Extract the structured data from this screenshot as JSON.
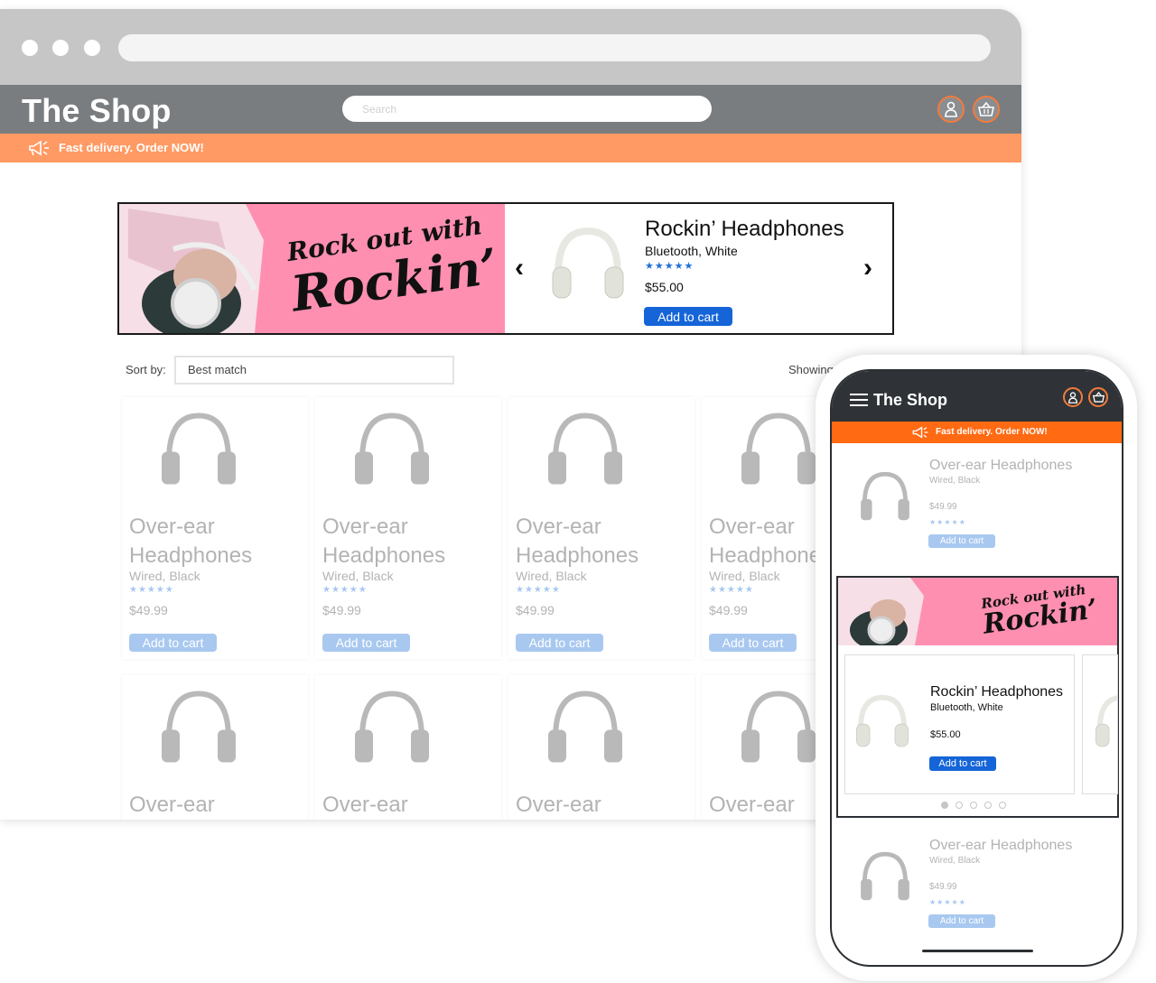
{
  "desktop": {
    "brand": "The Shop",
    "search_placeholder": "Search",
    "promo": "Fast delivery. Order NOW!",
    "hero": {
      "tagline_line1": "Rock out with",
      "tagline_line2": "Rockin’",
      "product_title": "Rockin’ Headphones",
      "product_subtitle": "Bluetooth, White",
      "stars": "★★★★★",
      "price": "$55.00",
      "add_to_cart": "Add to cart",
      "prev_arrow": "‹",
      "next_arrow": "›"
    },
    "sort_label": "Sort by:",
    "sort_value": "Best match",
    "showing_label": "Showing",
    "products": [
      {
        "name": "Over-ear Headphones",
        "spec": "Wired, Black",
        "stars": "★★★★★",
        "price": "$49.99",
        "button": "Add to cart"
      },
      {
        "name": "Over-ear Headphones",
        "spec": "Wired, Black",
        "stars": "★★★★★",
        "price": "$49.99",
        "button": "Add to cart"
      },
      {
        "name": "Over-ear Headphones",
        "spec": "Wired, Black",
        "stars": "★★★★★",
        "price": "$49.99",
        "button": "Add to cart"
      },
      {
        "name": "Over-ear Headphone",
        "spec": "Wired, Black",
        "stars": "★★★★★",
        "price": "$49.99",
        "button": "Add to cart"
      }
    ],
    "row2_names": [
      "Over-ear",
      "Over-ear",
      "Over-ear",
      "Over-ear"
    ]
  },
  "mobile": {
    "brand": "The Shop",
    "promo": "Fast delivery. Order NOW!",
    "item_top": {
      "name": "Over-ear Headphones",
      "spec": "Wired, Black",
      "price": "$49.99",
      "stars": "★★★★★",
      "button": "Add to cart"
    },
    "hero": {
      "tagline_line1": "Rock out with",
      "tagline_line2": "Rockin’",
      "product_title": "Rockin’ Headphones",
      "product_subtitle": "Bluetooth, White",
      "price": "$55.00",
      "add_to_cart": "Add to cart"
    },
    "item_bottom": {
      "name": "Over-ear Headphones",
      "spec": "Wired, Black",
      "price": "$49.99",
      "stars": "★★★★★",
      "button": "Add to cart"
    }
  },
  "colors": {
    "topbar": "#7a7d80",
    "promo": "#ff9a64",
    "mobile_promo": "#ff6a13",
    "hero_pink": "#ff8fb1",
    "primary_button": "#1565d8",
    "faded_button": "#a8c8f0"
  },
  "icons": [
    "megaphone-icon",
    "user-icon",
    "basket-icon",
    "hamburger-menu-icon",
    "chevron-left-icon",
    "chevron-right-icon",
    "headphones-icon"
  ]
}
